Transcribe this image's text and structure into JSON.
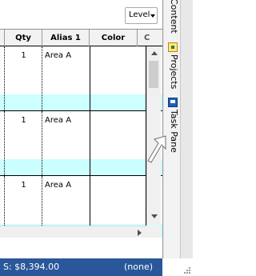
{
  "toolbar": {
    "level_label": "Level"
  },
  "grid": {
    "columns": [
      "Qty",
      "Alias 1",
      "Color",
      "C"
    ],
    "rows": [
      {
        "qty": "1",
        "alias": "Area A"
      },
      {
        "qty": "1",
        "alias": "Area A"
      },
      {
        "qty": "1",
        "alias": "Area A"
      }
    ]
  },
  "side_tabs": {
    "content": "Content",
    "projects": "Projects",
    "task_pane": "Task Pane"
  },
  "status_bar": {
    "total": "S: $8,394.00",
    "filter": "(none)"
  },
  "colors": {
    "status_bar_bg": "#2a579a",
    "row_highlight": "#ccffff",
    "header_bg": "#f2f2f2"
  },
  "icons": [
    "chevron-down-icon",
    "projects-icon",
    "task-pane-icon",
    "scroll-up-icon",
    "scroll-down-icon",
    "scroll-right-icon",
    "mouse-cursor-icon",
    "resize-grip-icon"
  ]
}
